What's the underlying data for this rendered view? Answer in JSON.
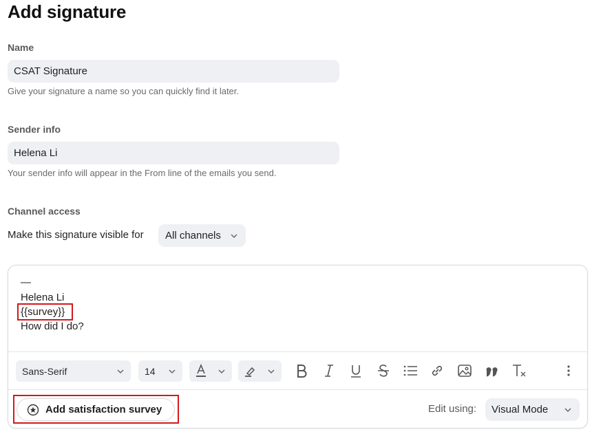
{
  "page": {
    "title": "Add signature"
  },
  "name_field": {
    "label": "Name",
    "value": "CSAT Signature",
    "hint": "Give your signature a name so you can quickly find it later."
  },
  "sender_field": {
    "label": "Sender info",
    "value": "Helena Li",
    "hint": "Your sender info will appear in the From line of the emails you send."
  },
  "channel_access": {
    "label": "Channel access",
    "visible_for_label": "Make this signature visible for",
    "selected": "All channels"
  },
  "editor": {
    "lines": [
      "—",
      "Helena Li",
      "{{survey}}",
      "How did I do?"
    ],
    "toolbar": {
      "font_family": "Sans-Serif",
      "font_size": "14",
      "icons": [
        "text-color-icon",
        "highlight-icon",
        "bold-icon",
        "italic-icon",
        "underline-icon",
        "strikethrough-icon",
        "bullet-list-icon",
        "link-icon",
        "image-icon",
        "quote-icon",
        "clear-format-icon",
        "more-options-icon"
      ]
    },
    "footer": {
      "survey_button": "Add satisfaction survey",
      "edit_using_label": "Edit using:",
      "edit_mode": "Visual Mode"
    }
  },
  "colors": {
    "highlight": "#d3181b",
    "input_bg": "#eef0f3"
  }
}
